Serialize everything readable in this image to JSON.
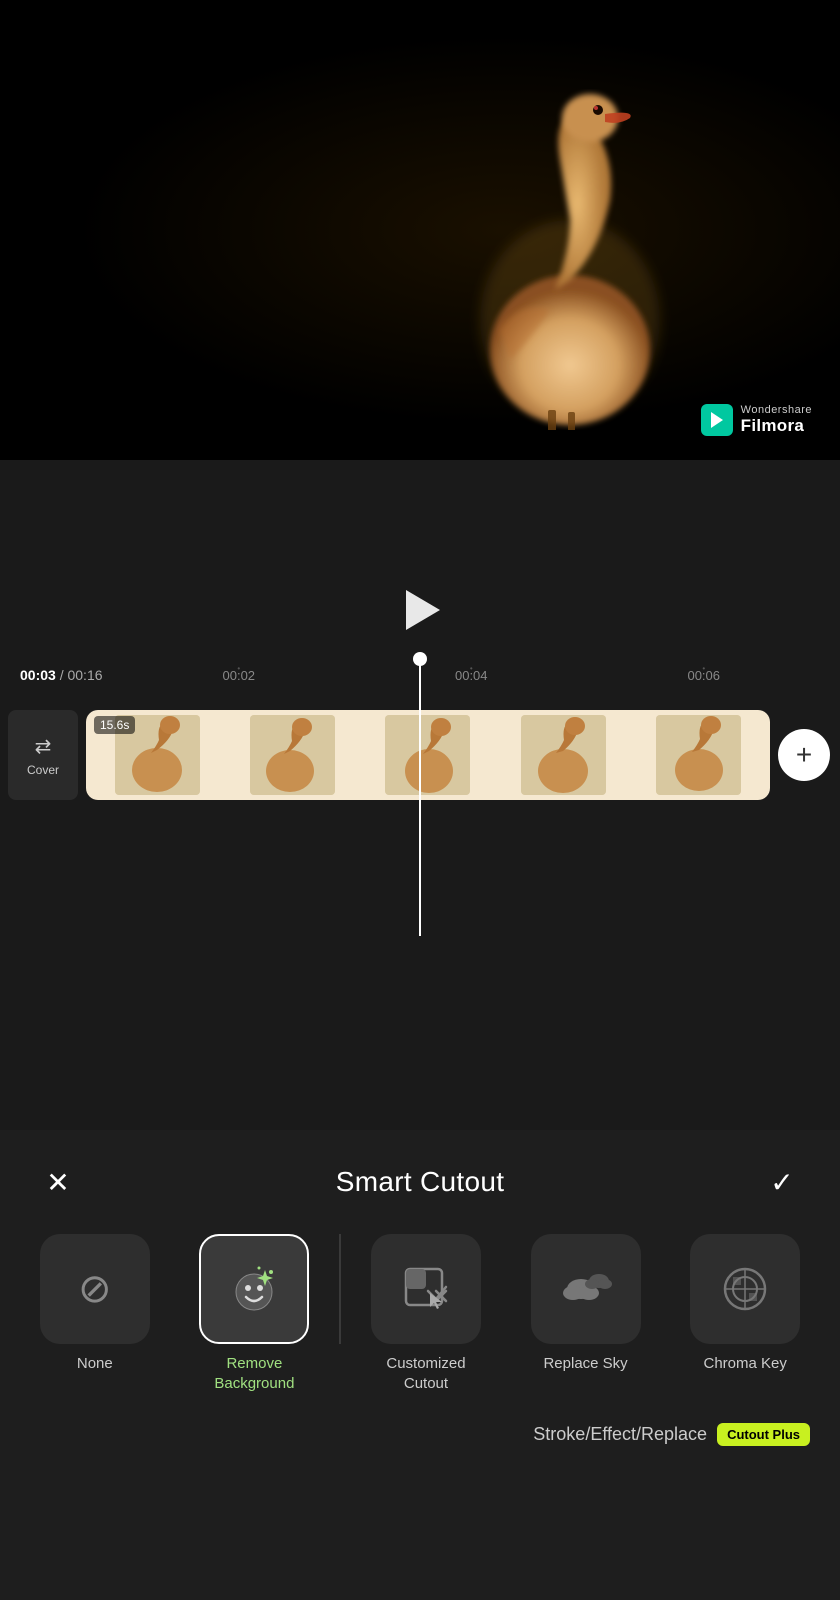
{
  "app": {
    "name": "Filmora",
    "brand": "Wondershare"
  },
  "video_preview": {
    "watermark_brand": "Wondershare",
    "watermark_app": "Filmora"
  },
  "timeline": {
    "current_time": "00:03",
    "total_time": "00:16",
    "time_marks": [
      "00:02",
      "00:04",
      "00:06"
    ],
    "track_duration": "15.6s",
    "cover_label": "Cover",
    "add_button_label": "+"
  },
  "panel": {
    "title": "Smart Cutout",
    "close_label": "×",
    "confirm_label": "✓",
    "options": [
      {
        "id": "none",
        "label": "None",
        "icon": "🚫",
        "selected": false
      },
      {
        "id": "remove-background",
        "label": "Remove\nBackground",
        "icon": "😊✨",
        "selected": true
      },
      {
        "id": "customized-cutout",
        "label": "Customized\nCutout",
        "icon": "⬛",
        "selected": false
      },
      {
        "id": "replace-sky",
        "label": "Replace Sky",
        "icon": "☁️",
        "selected": false
      },
      {
        "id": "chroma-key",
        "label": "Chroma Key",
        "icon": "⊞",
        "selected": false
      }
    ],
    "bottom_hint": "Stroke/Effect/Replace",
    "cutout_plus_label": "Cutout Plus"
  }
}
